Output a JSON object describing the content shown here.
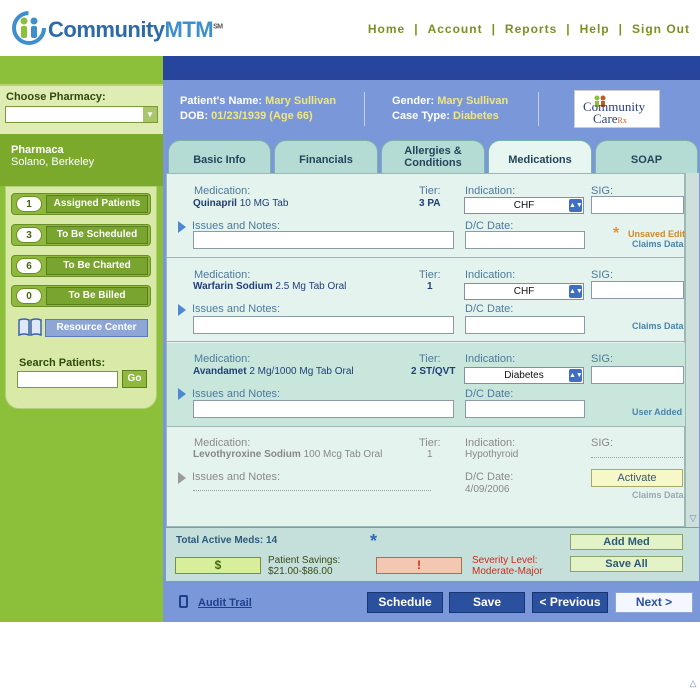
{
  "header": {
    "logo_text_a": "Community",
    "logo_text_b": "MTM",
    "logo_sm": "SM",
    "nav": [
      "Home",
      "Account",
      "Reports",
      "Help",
      "Sign Out"
    ],
    "nav_sep": "|"
  },
  "sidebar": {
    "choose_label": "Choose Pharmacy:",
    "choose_value": "",
    "pharmacy_name": "Pharmaca",
    "pharmacy_location": "Solano, Berkeley",
    "buttons": [
      {
        "count": "1",
        "label": "Assigned Patients"
      },
      {
        "count": "3",
        "label": "To Be Scheduled"
      },
      {
        "count": "6",
        "label": "To Be Charted"
      },
      {
        "count": "0",
        "label": "To Be Billed"
      }
    ],
    "resource_label": "Resource Center",
    "search_label": "Search Patients:",
    "search_value": "",
    "go_label": "Go"
  },
  "patient": {
    "name_label": "Patient's Name:",
    "name": "Mary Sullivan",
    "dob_label": "DOB:",
    "dob": "01/23/1939 (Age 66)",
    "gender_label": "Gender:",
    "gender": "Mary Sullivan",
    "case_label": "Case Type:",
    "case_type": "Diabetes",
    "partner_logo_a": "Community",
    "partner_logo_b": "Care",
    "partner_logo_c": "Rx"
  },
  "tabs": [
    "Basic Info",
    "Financials",
    "Allergies & Conditions",
    "Medications",
    "SOAP"
  ],
  "active_tab": "Medications",
  "labels": {
    "medication": "Medication:",
    "tier": "Tier:",
    "indication": "Indication:",
    "sig": "SIG:",
    "issues": "Issues and Notes:",
    "dc_date": "D/C Date:"
  },
  "medications": [
    {
      "name": "Quinapril",
      "dose": "10 MG Tab",
      "tier": "3 PA",
      "indication": "CHF",
      "dc_date": "",
      "sig": "",
      "issues": "",
      "note1": "Unsaved Edit",
      "note2": "Claims Data"
    },
    {
      "name": "Warfarin Sodium",
      "dose": "2.5 Mg Tab Oral",
      "tier": "1",
      "indication": "CHF",
      "dc_date": "",
      "sig": "",
      "issues": "",
      "note2": "Claims Data"
    },
    {
      "name": "Avandamet",
      "dose": "2 Mg/1000 Mg Tab Oral",
      "tier": "2 ST/QVT",
      "indication": "Diabetes",
      "dc_date": "",
      "sig": "",
      "issues": "",
      "note2": "User Added"
    },
    {
      "name": "Levothyroxine Sodium",
      "dose": "100 Mcg Tab Oral",
      "tier": "1",
      "indication": "Hypothyroid",
      "dc_date": "4/09/2006",
      "sig": "",
      "issues": "",
      "activate_label": "Activate",
      "note2": "Claims Data"
    }
  ],
  "summary": {
    "total_label": "Total Active Meds: 14",
    "star": "*",
    "dollar": "$",
    "savings_line1": "Patient Savings:",
    "savings_line2": "$21.00-$86.00",
    "warn": "!",
    "severity_line1": "Severity Level:",
    "severity_line2": "Moderate-Major",
    "add_med": "Add Med",
    "save_all": "Save All"
  },
  "footer": {
    "audit": "Audit Trail",
    "schedule": "Schedule",
    "save": "Save",
    "previous": "< Previous",
    "next": "Next >"
  },
  "colors": {
    "brand_green": "#8cbf3a",
    "brand_blue": "#27459c",
    "panel_mint": "#e4f3ee",
    "patient_value": "#f0e77a",
    "warning_red": "#cf2a1a"
  }
}
